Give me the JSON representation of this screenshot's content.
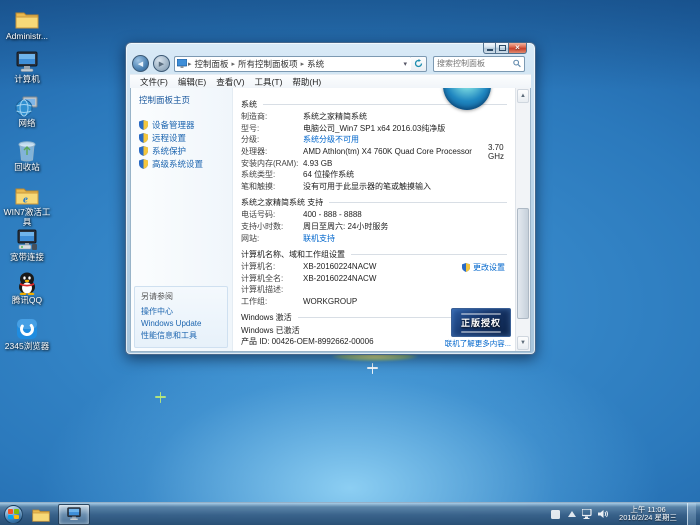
{
  "desktop": {
    "icons": [
      {
        "label": "Administr..."
      },
      {
        "label": "计算机"
      },
      {
        "label": "网络"
      },
      {
        "label": "回收站"
      },
      {
        "label": "WIN7激活工具"
      },
      {
        "label": "宽带连接"
      },
      {
        "label": "腾讯QQ"
      },
      {
        "label": "2345浏览器"
      }
    ]
  },
  "window": {
    "icons": {
      "back": "◀",
      "forward": "▶",
      "dropdown": "▾",
      "crumb_sep": "▸",
      "scroll_up": "▲",
      "scroll_down": "▼",
      "close": "×"
    },
    "nav": {
      "breadcrumb": [
        "控制面板",
        "所有控制面板项",
        "系统"
      ],
      "search_placeholder": "搜索控制面板"
    },
    "menu": [
      "文件(F)",
      "编辑(E)",
      "查看(V)",
      "工具(T)",
      "帮助(H)"
    ],
    "sidebar": {
      "home": "控制面板主页",
      "tasks": [
        "设备管理器",
        "远程设置",
        "系统保护",
        "高级系统设置"
      ],
      "see_also": {
        "header": "另请参阅",
        "items": [
          "操作中心",
          "Windows Update",
          "性能信息和工具"
        ]
      }
    },
    "main": {
      "system": {
        "header": "系统",
        "rows": [
          {
            "label": "制造商:",
            "value": "系统之家精简系统"
          },
          {
            "label": "型号:",
            "value": "电脑公司_Win7 SP1 x64 2016.03纯净版"
          },
          {
            "label": "分级:",
            "value": "系统分级不可用"
          },
          {
            "label": "处理器:",
            "value": "AMD Athlon(tm) X4 760K Quad Core Processor",
            "extra": "3.70 GHz"
          },
          {
            "label": "安装内存(RAM):",
            "value": "4.93 GB"
          },
          {
            "label": "系统类型:",
            "value": "64 位操作系统"
          },
          {
            "label": "笔和触摸:",
            "value": "没有可用于此显示器的笔或触摸输入"
          }
        ]
      },
      "support": {
        "header": "系统之家精简系统 支持",
        "rows": [
          {
            "label": "电话号码:",
            "value": "400 - 888 - 8888"
          },
          {
            "label": "支持小时数:",
            "value": "周日至周六: 24小时服务"
          },
          {
            "label": "网站:",
            "value": "联机支持"
          }
        ]
      },
      "computer": {
        "header": "计算机名称、域和工作组设置",
        "rows": [
          {
            "label": "计算机名:",
            "value": "XB-20160224NACW"
          },
          {
            "label": "计算机全名:",
            "value": "XB-20160224NACW"
          },
          {
            "label": "计算机描述:",
            "value": ""
          },
          {
            "label": "工作组:",
            "value": "WORKGROUP"
          }
        ],
        "change_link": "更改设置"
      },
      "activation": {
        "header": "Windows 激活",
        "status": "Windows 已激活",
        "product": "产品 ID: 00426-OEM-8992662-00006",
        "badge": "正版授权",
        "more_link": "联机了解更多内容..."
      }
    }
  },
  "taskbar": {
    "clock_time": "上午 11:06",
    "clock_date": "2016/2/24 星期三"
  }
}
